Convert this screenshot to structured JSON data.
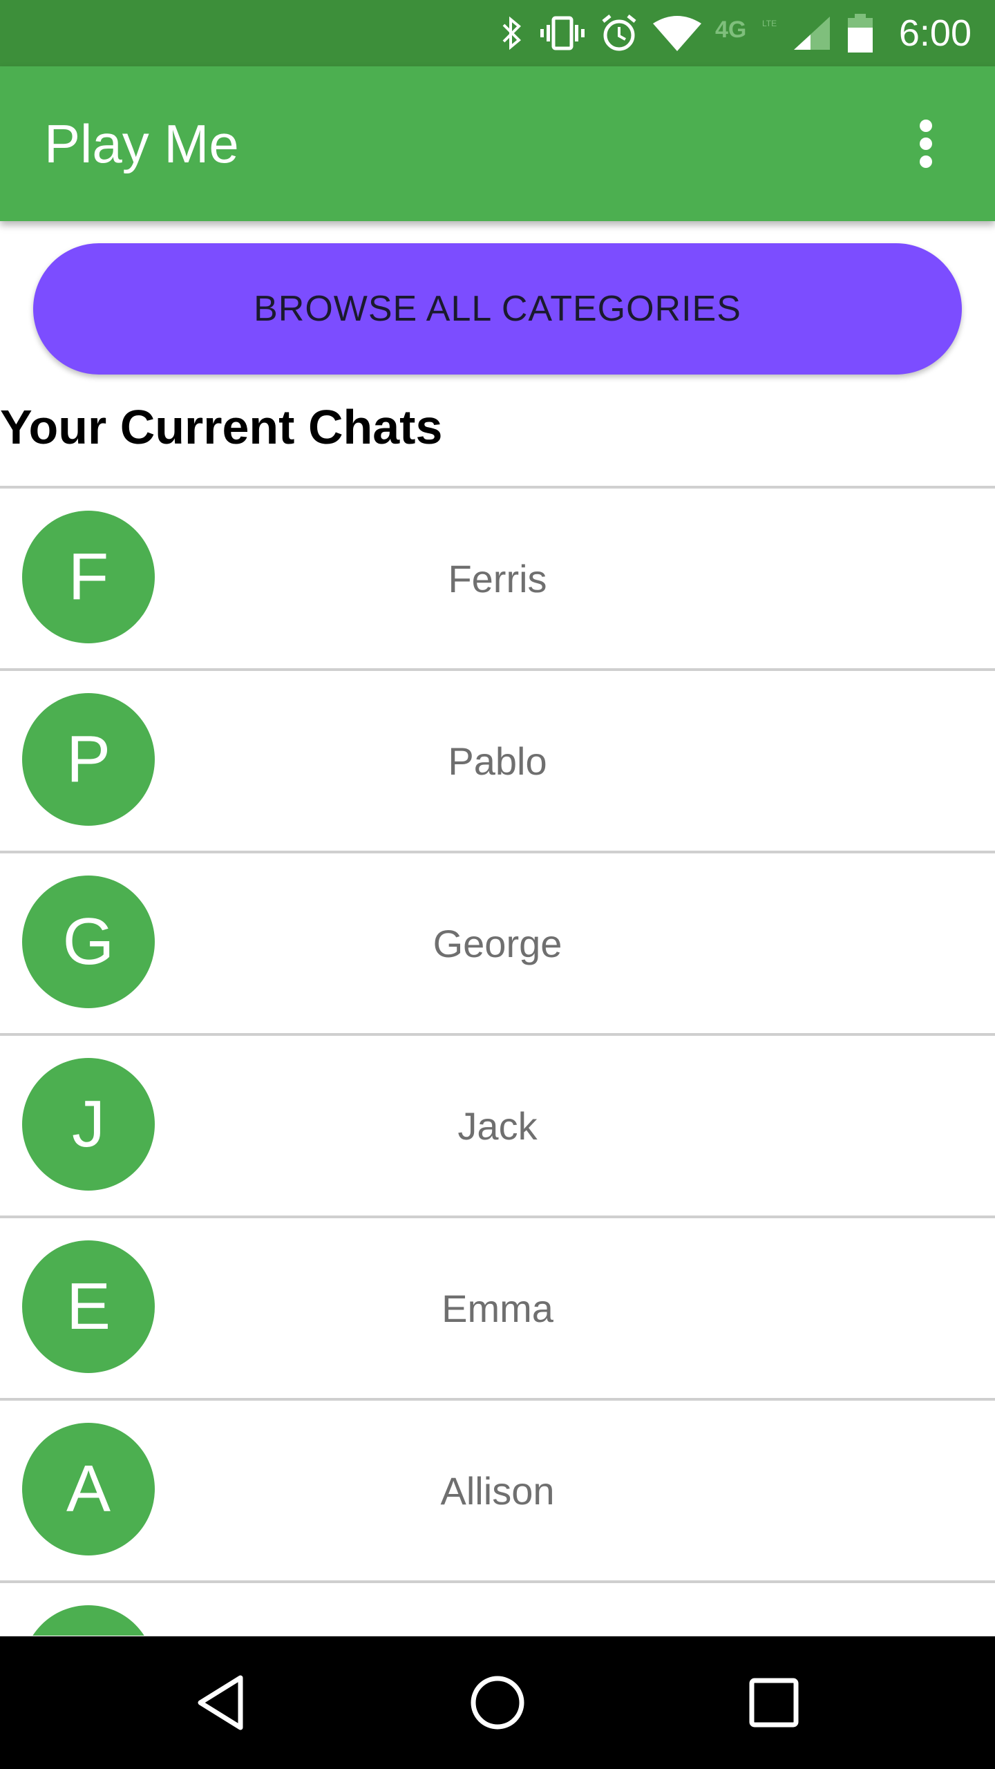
{
  "status_bar": {
    "time": "6:00",
    "network_label": "4G",
    "icons": [
      "bluetooth-icon",
      "vibrate-icon",
      "alarm-icon",
      "wifi-icon",
      "lte-icon",
      "signal-icon",
      "battery-icon"
    ]
  },
  "app_bar": {
    "title": "Play Me",
    "menu_icon": "overflow-menu-icon",
    "color": "#4caf50"
  },
  "browse_button": {
    "label": "BROWSE ALL CATEGORIES",
    "color": "#7c4dff"
  },
  "section": {
    "title": "Your Current Chats"
  },
  "chats": [
    {
      "initial": "F",
      "name": "Ferris"
    },
    {
      "initial": "P",
      "name": "Pablo"
    },
    {
      "initial": "G",
      "name": "George"
    },
    {
      "initial": "J",
      "name": "Jack"
    },
    {
      "initial": "E",
      "name": "Emma"
    },
    {
      "initial": "A",
      "name": "Allison"
    },
    {
      "initial": "",
      "name": ""
    }
  ],
  "nav_bar": {
    "icons": [
      "back-icon",
      "home-icon",
      "recents-icon"
    ]
  },
  "colors": {
    "status_bar": "#3d8f3a",
    "avatar": "#4caf50",
    "nav_bar": "#000000"
  }
}
